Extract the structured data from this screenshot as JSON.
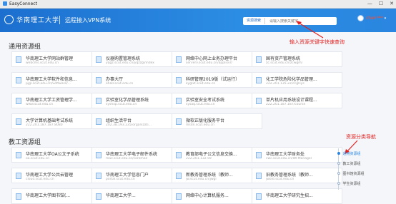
{
  "window": {
    "title": "EasyConnect",
    "minimize": "—",
    "maximize": "☐",
    "close": "✕"
  },
  "header": {
    "university": "华南理工大学",
    "system_title": "远程接入VPN系统",
    "search_button": "资源搜索",
    "search_placeholder": "请输入搜索关键字",
    "username": "chen***",
    "user_caret": "▾"
  },
  "sections": [
    {
      "title": "通用资源组",
      "cards": [
        {
          "title": "华南理工大学网站群管理",
          "sub": "webcms.scut.edu.cn"
        },
        {
          "title": "仪器购置管理系统",
          "sub": "yqgz.scut.edu.cn/yqzzgl/index"
        },
        {
          "title": "网络中心网上业务办理平台",
          "sub": "serverv.scut.edu.cn/applisvr/"
        },
        {
          "title": "国有资产管理系统",
          "sub": "zc.scut.edu.cn/zcwgm/"
        },
        {
          "title": "华南理工大学软件和信息...",
          "sub": "pjgl.scut.edu.cn/Software/..."
        },
        {
          "title": "办事大厅",
          "sub": "ehall.scut.edu.cn"
        },
        {
          "title": "科研管理2019版（试运行）",
          "sub": "kyglxt.scut.edu.cn"
        },
        {
          "title": "化工学院危险化学品管理...",
          "sub": "222.201.135.22/ccglsys"
        },
        {
          "title": "华南理工大学工资管理学...",
          "sub": "www.scut.edu.cn"
        },
        {
          "title": "实验室化学品管理系统",
          "sub": "syshxp.scut.edu.cn"
        },
        {
          "title": "实验室安全考试系统",
          "sub": "sysaq.scut.edu.cn"
        },
        {
          "title": "单片机应用系统设计课程...",
          "sub": "222.201.187.187/course"
        },
        {
          "title": "大学计算机基础考试系统",
          "sub": "222.201.187.187:8080"
        },
        {
          "title": "组织生活平台",
          "sub": "202.38.193.235/organizati..."
        },
        {
          "title": "微软正版化服务平台",
          "sub": "msdn.scut.edu.cn"
        }
      ]
    },
    {
      "title": "教工资源组",
      "cards": [
        {
          "title": "华南理工大学OA公文子系统",
          "sub": "oa.scut.edu.cn",
          "filter": false
        },
        {
          "title": "华南理工大学电子邮件系统",
          "sub": "mail.scut.edu.cn/coremail",
          "filter": false
        },
        {
          "title": "教育部电子公文信息交换...",
          "sub": "222.201.132.59",
          "filter": true
        },
        {
          "title": "华南理工大学财务处",
          "sub": "cwc.scut.edu.cn/WFManager",
          "filter": false
        },
        {
          "title": "华南理工大学公共云管理",
          "sub": "cloud.scut.edu.cn",
          "filter": false
        },
        {
          "title": "华南理工大学信息门户",
          "sub": "portal.scut.edu.cn",
          "filter": false
        },
        {
          "title": "新教务管理系统（教师...",
          "sub": "jw.scut.edu.cn/jwgl",
          "filter": false
        },
        {
          "title": "旧教务管理系统（教师...",
          "sub": "jwold.scut.edu.cn",
          "filter": false
        },
        {
          "title": "华南理工大学图书馆(...",
          "sub": "",
          "filter": false
        },
        {
          "title": "华南理工大学...",
          "sub": "",
          "filter": false
        },
        {
          "title": "网络中心计算机服务...",
          "sub": "",
          "filter": false
        },
        {
          "title": "华南理工大学研究生招...",
          "sub": "",
          "filter": false
        }
      ]
    }
  ],
  "annotations": {
    "search": "输入资源关键字快速查询",
    "nav": "资源分类导航"
  },
  "sidenav": [
    {
      "label": "通用资源组",
      "active": true
    },
    {
      "label": "教工资源组",
      "active": false
    },
    {
      "label": "图书馆资源组",
      "active": false
    },
    {
      "label": "学生资源组",
      "active": false
    }
  ]
}
